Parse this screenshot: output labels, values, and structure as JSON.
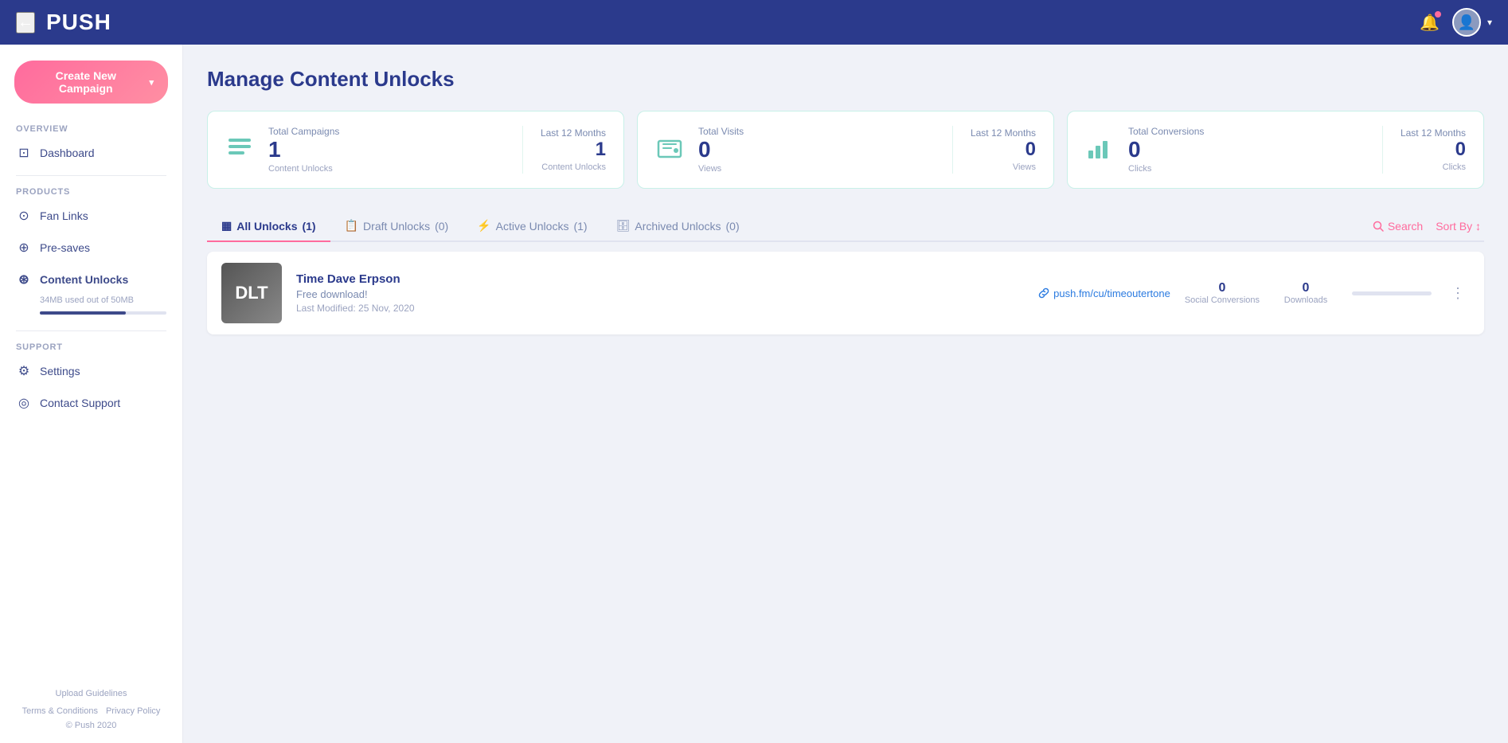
{
  "header": {
    "back_label": "←",
    "logo": "PUSH",
    "chevron": "▾"
  },
  "create_btn": {
    "label": "Create New Campaign",
    "chevron": "▾"
  },
  "sidebar": {
    "overview_label": "OVERVIEW",
    "products_label": "PRODUCTS",
    "support_label": "SUPPORT",
    "items": [
      {
        "id": "dashboard",
        "label": "Dashboard",
        "icon": "⊡"
      },
      {
        "id": "fan-links",
        "label": "Fan Links",
        "icon": "⊙"
      },
      {
        "id": "pre-saves",
        "label": "Pre-saves",
        "icon": "⊕"
      },
      {
        "id": "content-unlocks",
        "label": "Content Unlocks",
        "icon": "⊛",
        "active": true,
        "storage": "34MB used out of 50MB"
      },
      {
        "id": "settings",
        "label": "Settings",
        "icon": "⚙"
      },
      {
        "id": "contact-support",
        "label": "Contact Support",
        "icon": "◎"
      }
    ],
    "footer": {
      "links": [
        "Upload Guidelines",
        "Terms & Conditions",
        "Privacy Policy"
      ],
      "copyright": "© Push 2020"
    }
  },
  "page": {
    "title": "Manage Content Unlocks"
  },
  "stats": [
    {
      "id": "total-campaigns",
      "icon": "≡",
      "label": "Total Campaigns",
      "value": "1",
      "sub": "Content Unlocks",
      "last12label": "Last 12 Months",
      "last12value": "1",
      "last12sub": "Content Unlocks"
    },
    {
      "id": "total-visits",
      "icon": "💻",
      "label": "Total Visits",
      "value": "0",
      "sub": "Views",
      "last12label": "Last 12 Months",
      "last12value": "0",
      "last12sub": "Views"
    },
    {
      "id": "total-conversions",
      "icon": "📊",
      "label": "Total Conversions",
      "value": "0",
      "sub": "Clicks",
      "last12label": "Last 12 Months",
      "last12value": "0",
      "last12sub": "Clicks"
    }
  ],
  "tabs": [
    {
      "id": "all",
      "label": "All Unlocks",
      "count": "(1)",
      "icon": "▦",
      "active": true
    },
    {
      "id": "draft",
      "label": "Draft Unlocks",
      "count": "(0)",
      "icon": "📋"
    },
    {
      "id": "active",
      "label": "Active Unlocks",
      "count": "(1)",
      "icon": "⚡"
    },
    {
      "id": "archived",
      "label": "Archived Unlocks",
      "count": "(0)",
      "icon": "🗄"
    }
  ],
  "tabs_actions": {
    "search_label": "Search",
    "sort_label": "Sort By ↕"
  },
  "campaigns": [
    {
      "id": "time-dave-erpson",
      "thumb_text": "DLT",
      "name": "Time Dave Erpson",
      "type": "Free download!",
      "date": "Last Modified: 25 Nov, 2020",
      "url": "push.fm/cu/timeoutertone",
      "social_conversions": "0",
      "social_conversions_label": "Social Conversions",
      "downloads": "0",
      "downloads_label": "Downloads"
    }
  ]
}
